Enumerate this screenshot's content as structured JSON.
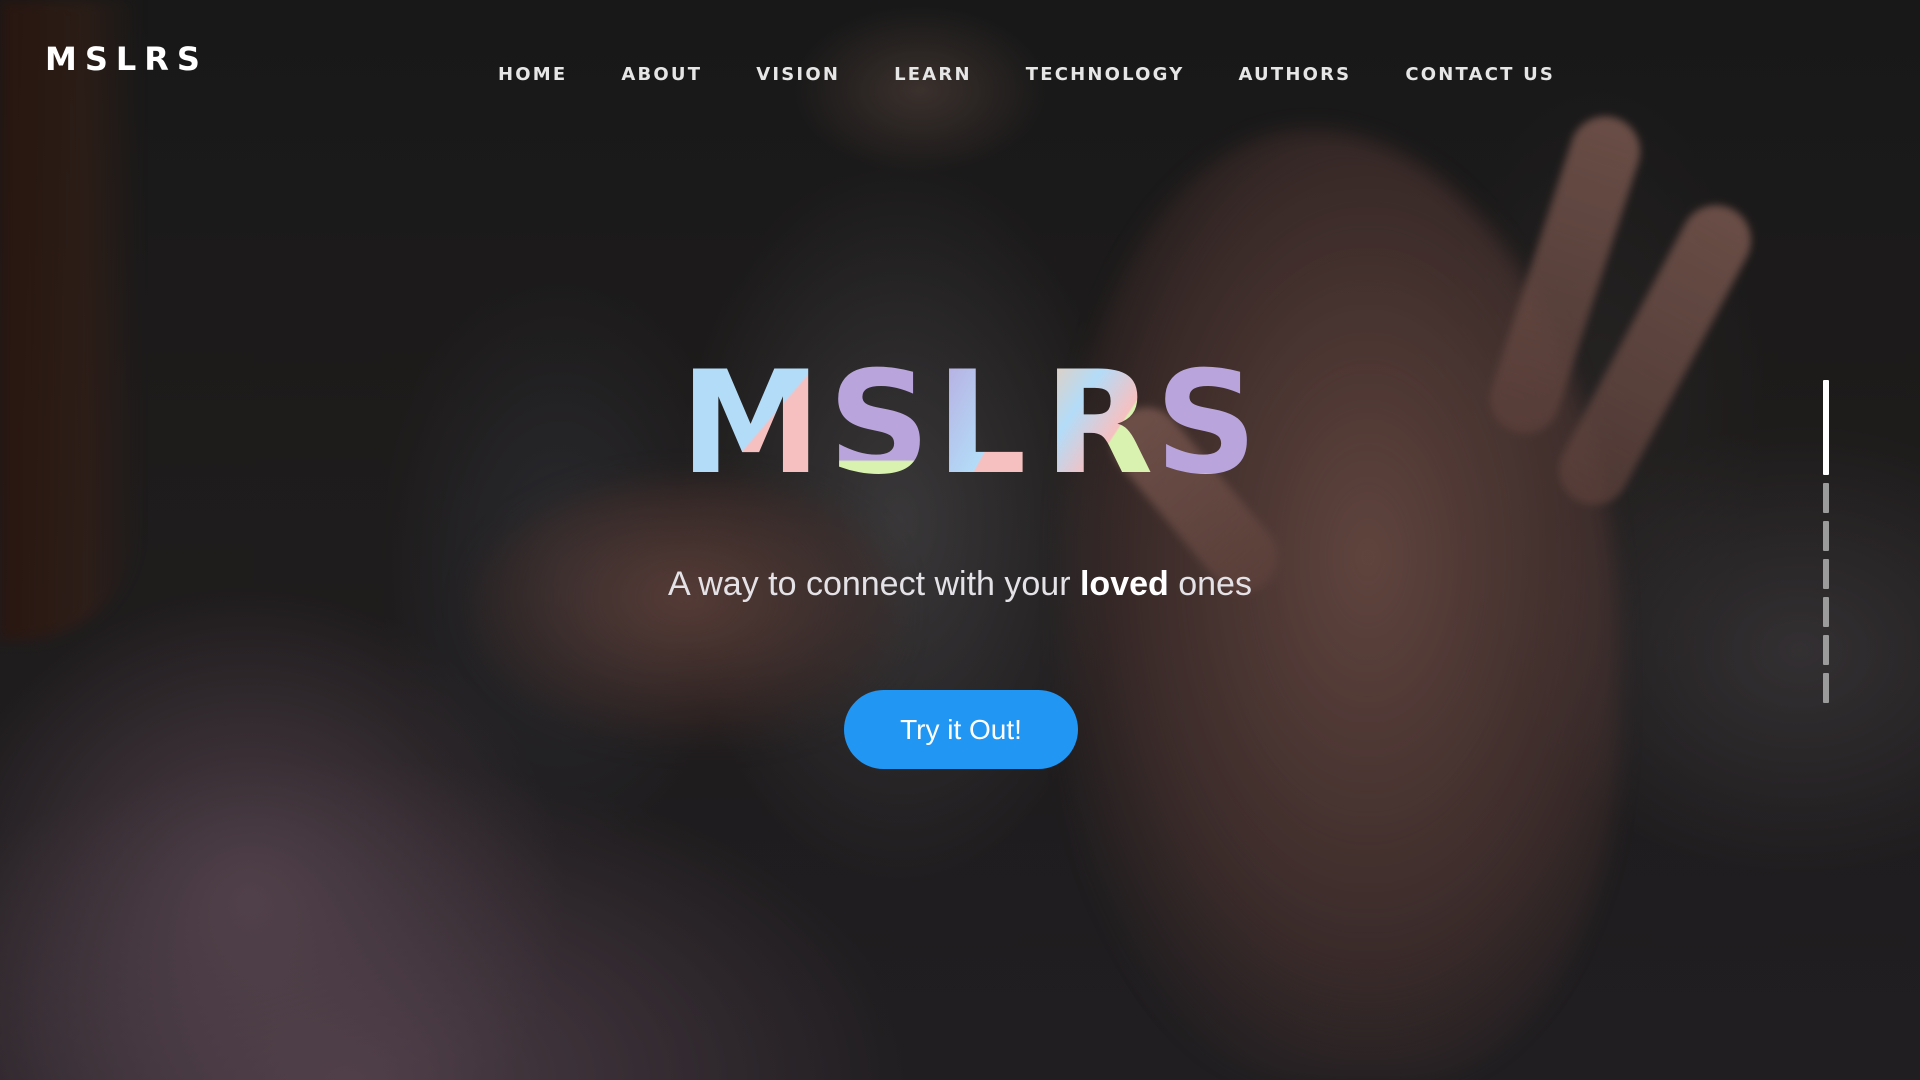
{
  "header": {
    "logo": "MSLRS",
    "nav": [
      {
        "label": "HOME"
      },
      {
        "label": "ABOUT"
      },
      {
        "label": "VISION"
      },
      {
        "label": "LEARN"
      },
      {
        "label": "TECHNOLOGY"
      },
      {
        "label": "AUTHORS"
      },
      {
        "label": "CONTACT US"
      }
    ]
  },
  "hero": {
    "title_letters": [
      "M",
      "S",
      "L",
      "R",
      "S"
    ],
    "tagline_prefix": "A way to connect with your ",
    "tagline_bold": "loved",
    "tagline_suffix": " ones",
    "cta_label": "Try it Out!"
  },
  "colors": {
    "cta_background": "#2196f3",
    "pastel_blue": "#b3dcf8",
    "pastel_lilac": "#b9a4dc",
    "pastel_pink": "#f6c0c0",
    "pastel_green": "#d9f2b0",
    "pastel_peach": "#f6c9a8"
  },
  "section_indicator": {
    "count": 7,
    "active_index": 0
  }
}
